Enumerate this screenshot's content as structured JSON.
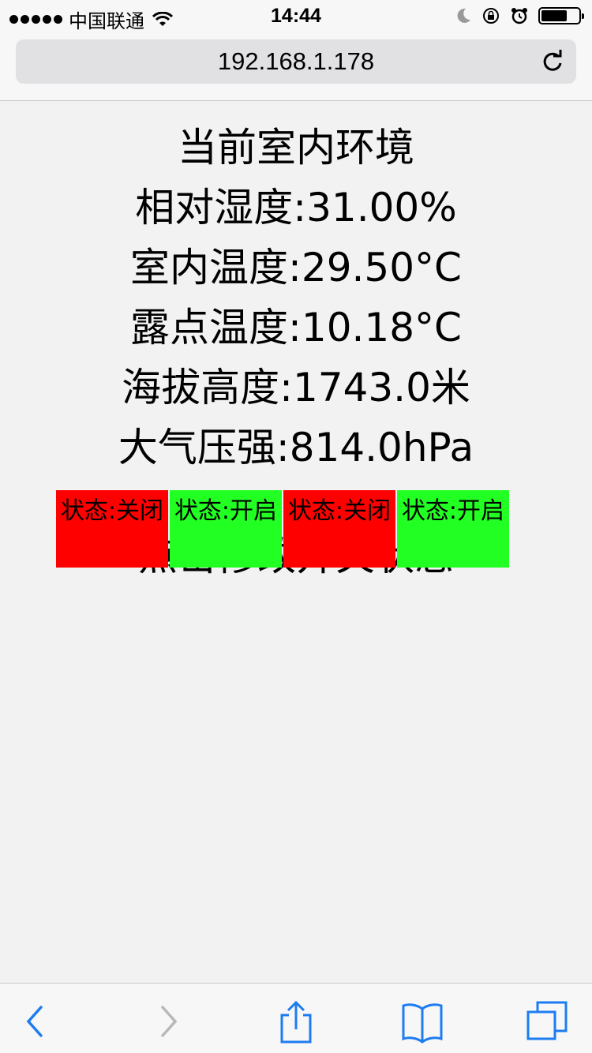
{
  "status_bar": {
    "carrier": "中国联通",
    "time": "14:44"
  },
  "browser": {
    "url": "192.168.1.178"
  },
  "environment": {
    "title": "当前室内环境",
    "humidity": "相对湿度:31.00%",
    "indoor_temp": "室内温度:29.50°C",
    "dew_point": "露点温度:10.18°C",
    "altitude": "海拔高度:1743.0米",
    "pressure": "大气压强:814.0hPa"
  },
  "switches": {
    "title": "点击修改开关状态",
    "items": [
      {
        "label": "状态:关闭",
        "state": "off"
      },
      {
        "label": "状态:开启",
        "state": "on"
      },
      {
        "label": "状态:关闭",
        "state": "off"
      },
      {
        "label": "状态:开启",
        "state": "on"
      }
    ]
  },
  "colors": {
    "off": "#ff0000",
    "on": "#22ff22",
    "toolbar_accent": "#1e7cf2"
  },
  "toolbar": {
    "icons": [
      "back-icon",
      "forward-icon",
      "share-icon",
      "bookmarks-icon",
      "tabs-icon"
    ]
  }
}
